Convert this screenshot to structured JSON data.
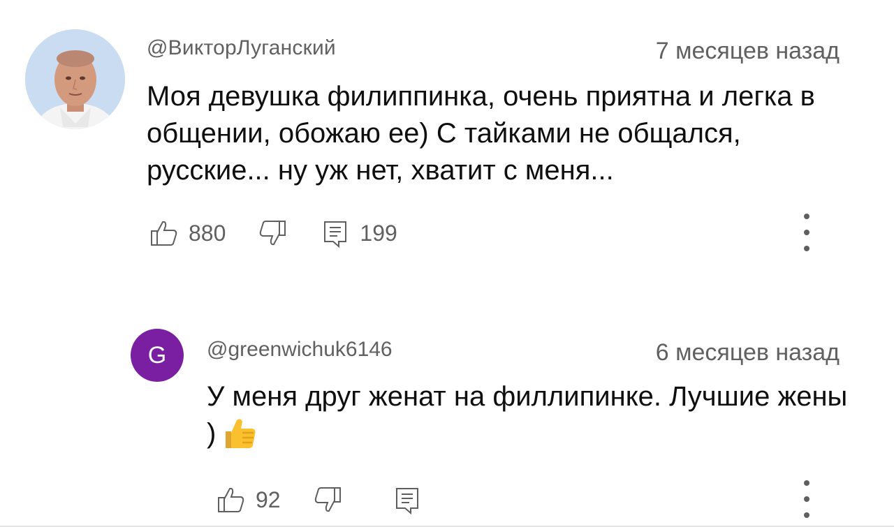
{
  "comments": [
    {
      "author": "@ВикторЛуганский",
      "time": "7 месяцев назад",
      "text": "Моя девушка филиппинка, очень приятна и легка в общении, обожаю ее) С тайками не общался, русские... ну уж нет, хватит с меня...",
      "likes": "880",
      "replies": "199",
      "avatar": "photo-avatar"
    },
    {
      "author": "@greenwichuk6146",
      "time": "6 месяцев назад",
      "text": "У меня друг женат на филлипинке. Лучшие жены )",
      "emoji": "👍",
      "likes": "92",
      "avatar_letter": "G",
      "avatar_color": "#7b1fa2"
    }
  ],
  "icons": {
    "like": "thumbs-up-icon",
    "dislike": "thumbs-down-icon",
    "reply": "comment-icon",
    "more": "more-vertical-icon"
  }
}
